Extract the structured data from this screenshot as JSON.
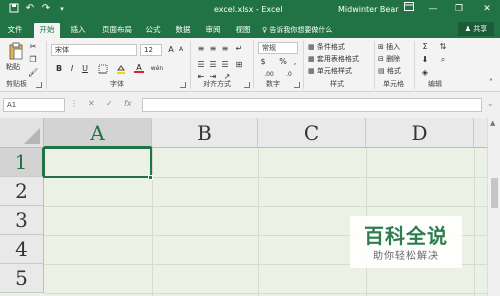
{
  "titlebar": {
    "title": "excel.xlsx  -  Excel",
    "user": "Midwinter Bear",
    "save_icon": "save-icon",
    "undo_icon": "undo-icon",
    "redo_icon": "redo-icon",
    "ribbon_display_icon": "ribbon-display-icon",
    "minimize": "—",
    "restore": "❐",
    "close": "✕"
  },
  "tabs": [
    {
      "label": "文件"
    },
    {
      "label": "开始",
      "active": true
    },
    {
      "label": "插入"
    },
    {
      "label": "页面布局"
    },
    {
      "label": "公式"
    },
    {
      "label": "数据"
    },
    {
      "label": "审阅"
    },
    {
      "label": "视图"
    }
  ],
  "tell_me": "告诉我你想要做什么",
  "share": "共享",
  "ribbon": {
    "clipboard": {
      "label": "剪贴板",
      "paste": "粘贴"
    },
    "font": {
      "label": "字体",
      "font_name": "宋体",
      "font_size": "12",
      "bold": "B",
      "italic": "I",
      "underline": "U",
      "font_color": "A",
      "wen": "wén"
    },
    "alignment": {
      "label": "对齐方式"
    },
    "number": {
      "label": "数字",
      "format": "常规",
      "percent": "%",
      "comma": ","
    },
    "styles": {
      "label": "样式",
      "conditional": "条件格式",
      "table": "套用表格格式",
      "cell_styles": "单元格样式"
    },
    "cells": {
      "label": "单元格",
      "insert": "插入",
      "delete": "删除",
      "format": "格式"
    },
    "editing": {
      "label": "编辑"
    }
  },
  "formula_bar": {
    "name_box": "A1",
    "cancel": "✕",
    "enter": "✓",
    "fx": "fx",
    "value": ""
  },
  "sheet": {
    "columns": [
      "A",
      "B",
      "C",
      "D"
    ],
    "rows": [
      "1",
      "2",
      "3",
      "4",
      "5"
    ],
    "selected_cell": "A1"
  },
  "watermark": {
    "title": "百科全说",
    "subtitle": "助你轻松解决"
  },
  "colors": {
    "accent": "#217346",
    "grid_bg": "#ecf1e6"
  }
}
